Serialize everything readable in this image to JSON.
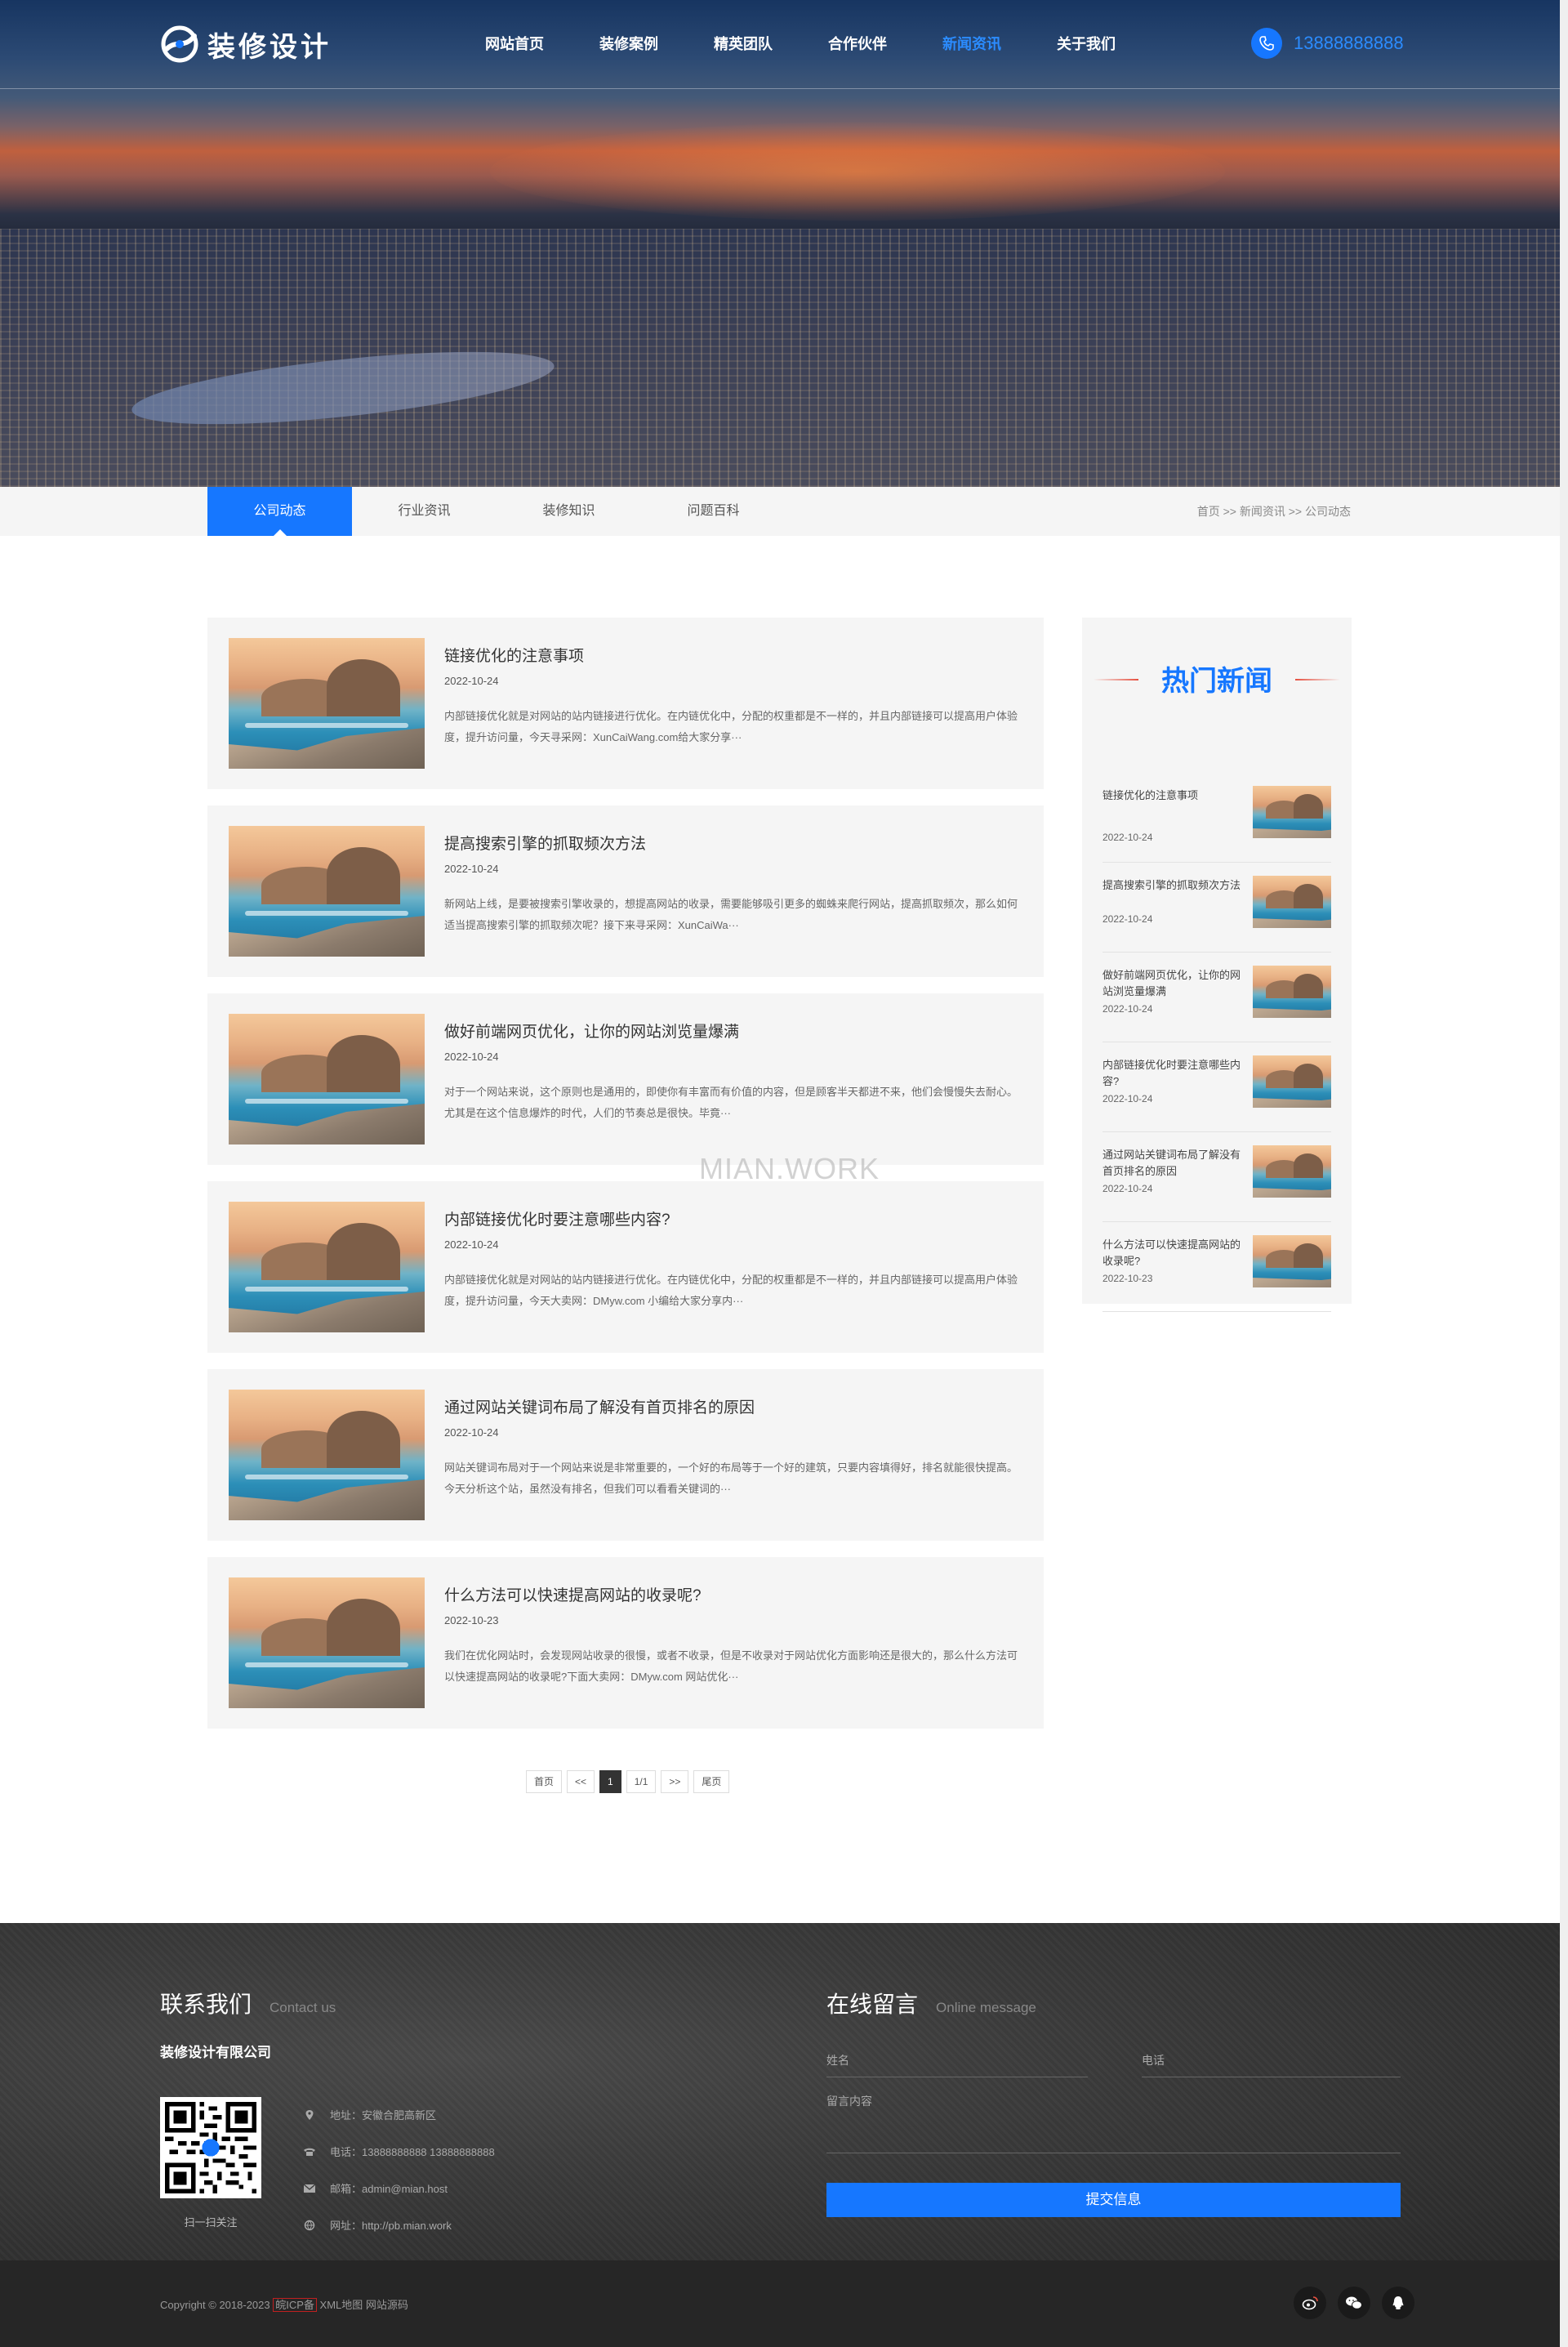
{
  "header": {
    "logo_text": "装修设计",
    "nav": [
      {
        "label": "网站首页"
      },
      {
        "label": "装修案例"
      },
      {
        "label": "精英团队"
      },
      {
        "label": "合作伙伴"
      },
      {
        "label": "新闻资讯",
        "active": true
      },
      {
        "label": "关于我们"
      }
    ],
    "phone": "13888888888"
  },
  "subnav": {
    "tabs": [
      {
        "label": "公司动态",
        "active": true
      },
      {
        "label": "行业资讯"
      },
      {
        "label": "装修知识"
      },
      {
        "label": "问题百科"
      }
    ],
    "breadcrumb": "首页 >> 新闻资讯 >> 公司动态"
  },
  "news": [
    {
      "title": "链接优化的注意事项",
      "date": "2022-10-24",
      "desc": "内部链接优化就是对网站的站内链接进行优化。在内链优化中，分配的权重都是不一样的，并且内部链接可以提高用户体验度，提升访问量，今天寻采网：XunCaiWang.com给大家分享···"
    },
    {
      "title": "提高搜索引擎的抓取频次方法",
      "date": "2022-10-24",
      "desc": "新网站上线，是要被搜索引擎收录的，想提高网站的收录，需要能够吸引更多的蜘蛛来爬行网站，提高抓取频次，那么如何适当提高搜索引擎的抓取频次呢？接下来寻采网：XunCaiWa···"
    },
    {
      "title": "做好前端网页优化，让你的网站浏览量爆满",
      "date": "2022-10-24",
      "desc": "对于一个网站来说，这个原则也是通用的，即使你有丰富而有价值的内容，但是顾客半天都进不来，他们会慢慢失去耐心。尤其是在这个信息爆炸的时代，人们的节奏总是很快。毕竟···"
    },
    {
      "title": "内部链接优化时要注意哪些内容?",
      "date": "2022-10-24",
      "desc": "内部链接优化就是对网站的站内链接进行优化。在内链优化中，分配的权重都是不一样的，并且内部链接可以提高用户体验度，提升访问量，今天大卖网：DMyw.com 小编给大家分享内···"
    },
    {
      "title": "通过网站关键词布局了解没有首页排名的原因",
      "date": "2022-10-24",
      "desc": "网站关键词布局对于一个网站来说是非常重要的，一个好的布局等于一个好的建筑，只要内容填得好，排名就能很快提高。今天分析这个站，虽然没有排名，但我们可以看看关键词的···"
    },
    {
      "title": "什么方法可以快速提高网站的收录呢?",
      "date": "2022-10-23",
      "desc": "我们在优化网站时，会发现网站收录的很慢，或者不收录，但是不收录对于网站优化方面影响还是很大的，那么什么方法可以快速提高网站的收录呢?下面大卖网：DMyw.com 网站优化···"
    }
  ],
  "pager": [
    "首页",
    "<<",
    "1",
    "1/1",
    ">>",
    "尾页"
  ],
  "sidebar": {
    "title": "热门新闻",
    "items": [
      {
        "title": "链接优化的注意事项",
        "date": "2022-10-24"
      },
      {
        "title": "提高搜索引擎的抓取频次方法",
        "date": "2022-10-24"
      },
      {
        "title": "做好前端网页优化，让你的网站浏览量爆满",
        "date": "2022-10-24"
      },
      {
        "title": "内部链接优化时要注意哪些内容?",
        "date": "2022-10-24"
      },
      {
        "title": "通过网站关键词布局了解没有首页排名的原因",
        "date": "2022-10-24"
      },
      {
        "title": "什么方法可以快速提高网站的收录呢?",
        "date": "2022-10-23"
      }
    ]
  },
  "watermark": "MIAN.WORK",
  "footer": {
    "contact_title": "联系我们",
    "contact_sub": "Contact us",
    "company": "装修设计有限公司",
    "qr_caption": "扫一扫关注",
    "address": "地址：安徽合肥高新区",
    "phone": "电话：13888888888   13888888888",
    "email": "邮箱：admin@mian.host",
    "website": "网址：http://pb.mian.work",
    "message_title": "在线留言",
    "message_sub": "Online message",
    "name_placeholder": "姓名",
    "phone_placeholder": "电话",
    "content_placeholder": "留言内容",
    "submit": "提交信息",
    "copyright": "Copyright © 2018-2023",
    "icp": "皖ICP备",
    "xml_map": "XML地图",
    "source": "网站源码"
  },
  "colors": {
    "accent": "#1677ff",
    "footer_bg": "#3a3a3a",
    "copyright_bg": "#262626"
  }
}
